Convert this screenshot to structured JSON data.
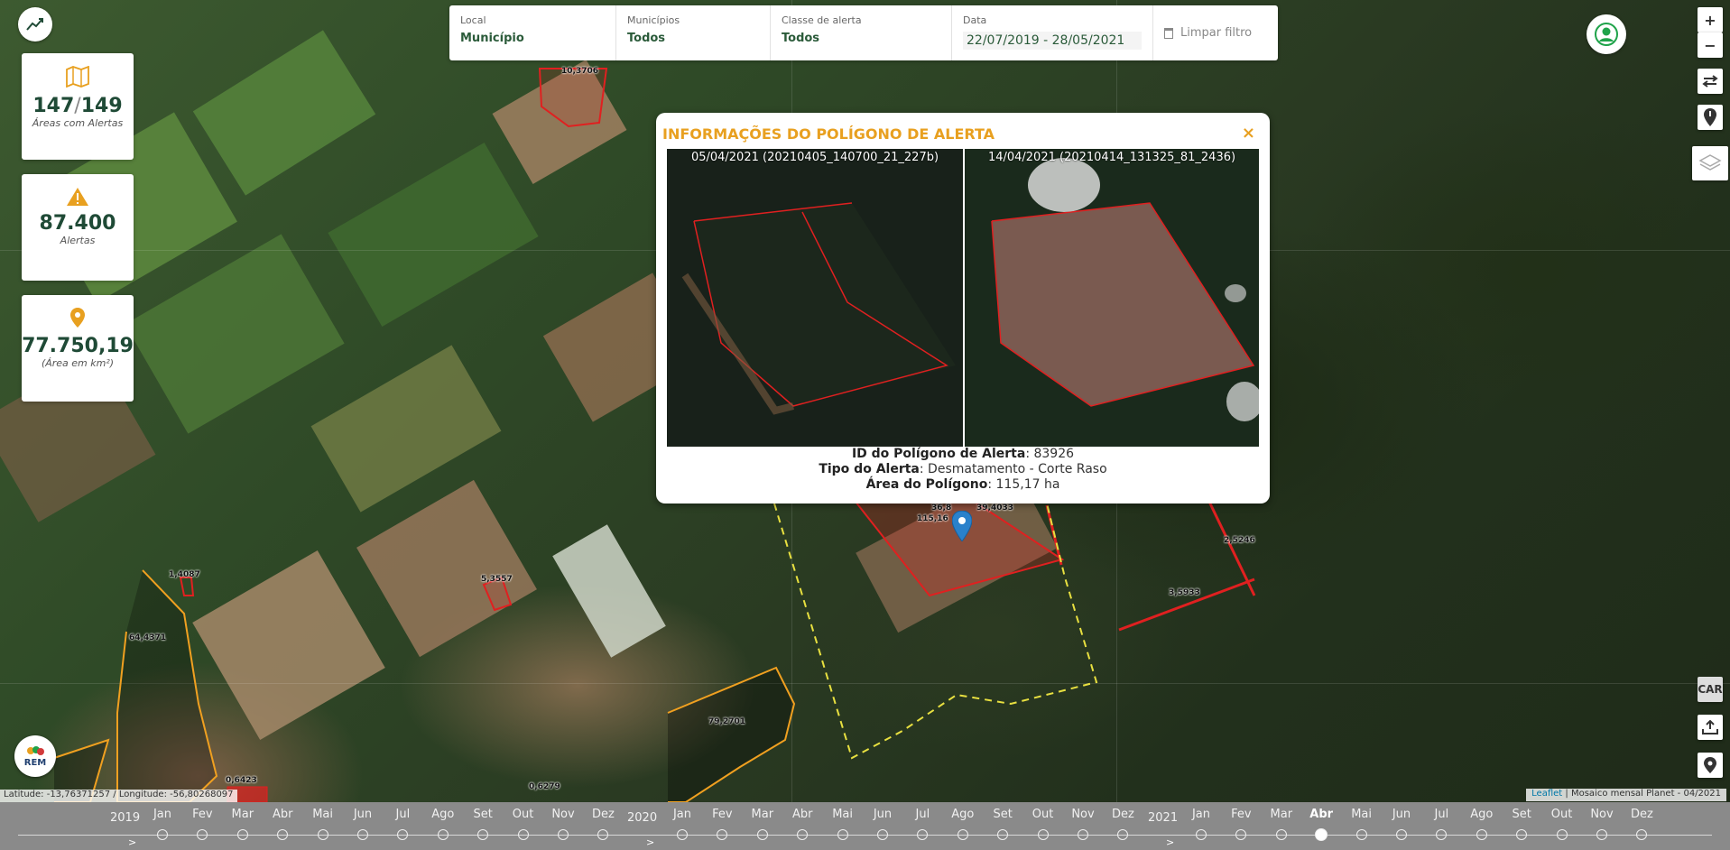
{
  "filters": {
    "local": {
      "label": "Local",
      "value": "Município"
    },
    "municipios": {
      "label": "Municípios",
      "value": "Todos"
    },
    "classe": {
      "label": "Classe de alerta",
      "value": "Todos"
    },
    "data": {
      "label": "Data",
      "value": "22/07/2019 - 28/05/2021"
    },
    "clear_label": "Limpar filtro"
  },
  "stats": [
    {
      "value_a": "147",
      "value_b": "149",
      "caption": "Áreas com Alertas",
      "icon": "map-icon"
    },
    {
      "value": "87.400",
      "caption": "Alertas",
      "icon": "warning-icon"
    },
    {
      "value": "77.750,19",
      "caption": "(Área em km²)",
      "icon": "map-pin-icon"
    }
  ],
  "colors": {
    "accent": "#e8a020",
    "brand": "#1f4a36",
    "alert_polygon": "#e02020",
    "car_polygon": "#f0a020"
  },
  "popup": {
    "title": "INFORMAÇÕES DO POLÍGONO DE ALERTA",
    "before_caption": "05/04/2021 (20210405_140700_21_227b)",
    "after_caption": "14/04/2021 (20210414_131325_81_2436)",
    "id_label": "ID do Polígono de Alerta",
    "id_value": "83926",
    "type_label": "Tipo do Alerta",
    "type_value": "Desmatamento - Corte Raso",
    "area_label": "Área do Polígono",
    "area_value": "115,17 ha"
  },
  "map_labels": [
    "10,3706",
    "1,4087",
    "64,4371",
    "5,3557",
    "79,2701",
    "0,6423",
    "0,6279",
    "36,8",
    "115,16",
    "39,4033",
    "2,5246",
    "3,5933"
  ],
  "controls": {
    "zoom_in": "+",
    "zoom_out": "−",
    "car_label": "CAR"
  },
  "footer": {
    "coords": "Latitude: -13,76371257 / Longitude: -56,80268097",
    "attribution_link": "Leaflet",
    "attribution_text": "| Mosaico mensal Planet - 04/2021"
  },
  "timeline": {
    "years": [
      "2019",
      "2020",
      "2021"
    ],
    "months_2019": [
      "Jan",
      "Fev",
      "Mar",
      "Abr",
      "Mai",
      "Jun",
      "Jul",
      "Ago",
      "Set",
      "Out",
      "Nov",
      "Dez"
    ],
    "months_2020": [
      "Jan",
      "Fev",
      "Mar",
      "Abr",
      "Mai",
      "Jun",
      "Jul",
      "Ago",
      "Set",
      "Out",
      "Nov",
      "Dez"
    ],
    "months_2021": [
      "Jan",
      "Fev",
      "Mar",
      "Abr",
      "Mai",
      "Jun",
      "Jul",
      "Ago",
      "Set",
      "Out",
      "Nov",
      "Dez"
    ],
    "selected": "Abr 2021",
    "arrow": ">"
  },
  "logo_text": "REM"
}
